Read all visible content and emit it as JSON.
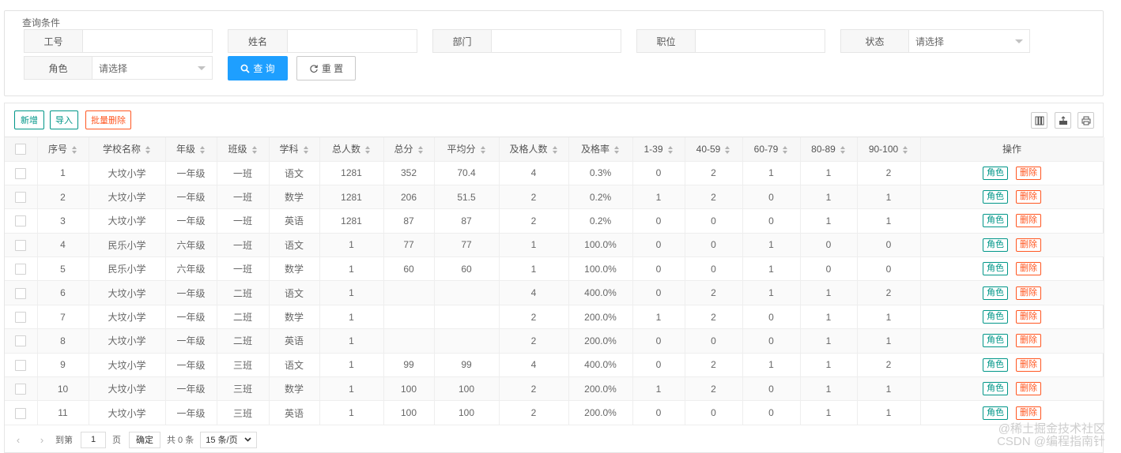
{
  "query": {
    "legend": "查询条件",
    "fields": {
      "job_no": {
        "label": "工号",
        "value": ""
      },
      "name": {
        "label": "姓名",
        "value": ""
      },
      "dept": {
        "label": "部门",
        "value": ""
      },
      "position": {
        "label": "职位",
        "value": ""
      },
      "status": {
        "label": "状态",
        "value": "请选择"
      },
      "role": {
        "label": "角色",
        "value": "请选择"
      }
    },
    "search_label": "查 询",
    "reset_label": "重 置"
  },
  "toolbar": {
    "add_label": "新增",
    "import_label": "导入",
    "batch_delete_label": "批量删除"
  },
  "table": {
    "headers": [
      "序号",
      "学校名称",
      "年级",
      "班级",
      "学科",
      "总人数",
      "总分",
      "平均分",
      "及格人数",
      "及格率",
      "1-39",
      "40-59",
      "60-79",
      "80-89",
      "90-100",
      "操作"
    ],
    "role_label": "角色",
    "delete_label": "删除",
    "rows": [
      [
        "1",
        "大坟小学",
        "一年级",
        "一班",
        "语文",
        "1281",
        "352",
        "70.4",
        "4",
        "0.3%",
        "0",
        "2",
        "1",
        "1",
        "2"
      ],
      [
        "2",
        "大坟小学",
        "一年级",
        "一班",
        "数学",
        "1281",
        "206",
        "51.5",
        "2",
        "0.2%",
        "1",
        "2",
        "0",
        "1",
        "1"
      ],
      [
        "3",
        "大坟小学",
        "一年级",
        "一班",
        "英语",
        "1281",
        "87",
        "87",
        "2",
        "0.2%",
        "0",
        "0",
        "0",
        "1",
        "1"
      ],
      [
        "4",
        "民乐小学",
        "六年级",
        "一班",
        "语文",
        "1",
        "77",
        "77",
        "1",
        "100.0%",
        "0",
        "0",
        "1",
        "0",
        "0"
      ],
      [
        "5",
        "民乐小学",
        "六年级",
        "一班",
        "数学",
        "1",
        "60",
        "60",
        "1",
        "100.0%",
        "0",
        "0",
        "1",
        "0",
        "0"
      ],
      [
        "6",
        "大坟小学",
        "一年级",
        "二班",
        "语文",
        "1",
        "",
        "",
        "4",
        "400.0%",
        "0",
        "2",
        "1",
        "1",
        "2"
      ],
      [
        "7",
        "大坟小学",
        "一年级",
        "二班",
        "数学",
        "1",
        "",
        "",
        "2",
        "200.0%",
        "1",
        "2",
        "0",
        "1",
        "1"
      ],
      [
        "8",
        "大坟小学",
        "一年级",
        "二班",
        "英语",
        "1",
        "",
        "",
        "2",
        "200.0%",
        "0",
        "0",
        "0",
        "1",
        "1"
      ],
      [
        "9",
        "大坟小学",
        "一年级",
        "三班",
        "语文",
        "1",
        "99",
        "99",
        "4",
        "400.0%",
        "0",
        "2",
        "1",
        "1",
        "2"
      ],
      [
        "10",
        "大坟小学",
        "一年级",
        "三班",
        "数学",
        "1",
        "100",
        "100",
        "2",
        "200.0%",
        "1",
        "2",
        "0",
        "1",
        "1"
      ],
      [
        "11",
        "大坟小学",
        "一年级",
        "三班",
        "英语",
        "1",
        "100",
        "100",
        "2",
        "200.0%",
        "0",
        "0",
        "0",
        "1",
        "1"
      ]
    ]
  },
  "pager": {
    "goto_label": "到第",
    "page_value": "1",
    "page_unit": "页",
    "confirm_label": "确定",
    "total_label": "共 0 条",
    "page_size": "15 条/页"
  },
  "watermark": {
    "line1": "@稀土掘金技术社区",
    "line2": "CSDN @编程指南针"
  },
  "colors": {
    "primary": "#1e9fff",
    "green": "#009688",
    "orange": "#ff5722"
  }
}
